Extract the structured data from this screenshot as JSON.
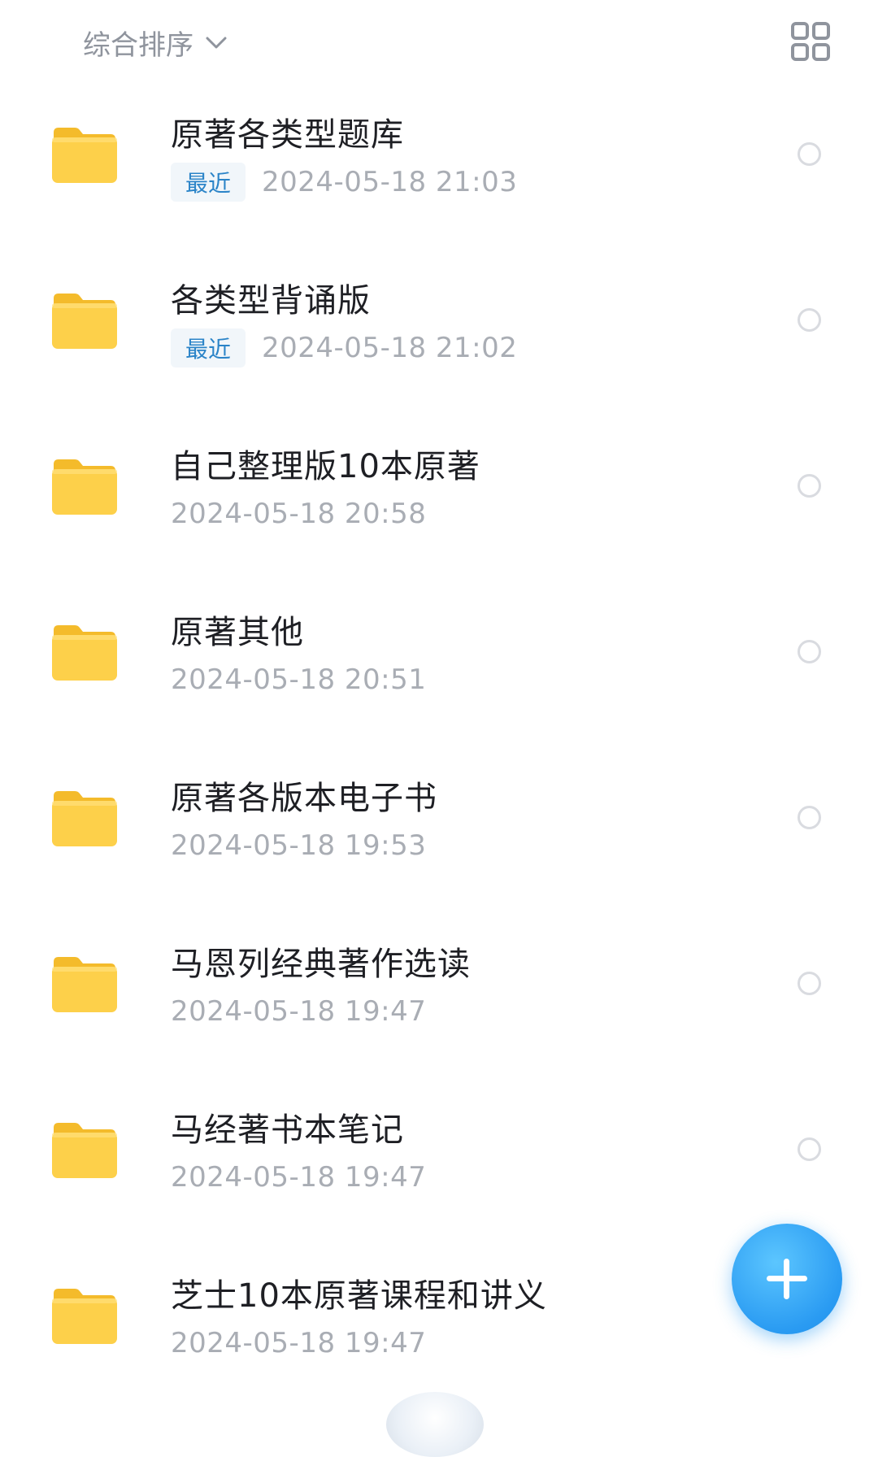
{
  "toolbar": {
    "sort_label": "综合排序",
    "sort_icon": "chevron-down-icon",
    "view_icon": "grid-view-icon"
  },
  "colors": {
    "folder": "#FDD04A",
    "accent": "#2A9BF2",
    "badge_text": "#2B84C8",
    "title_text": "#1E1F24",
    "date_text": "#A9ADB4"
  },
  "files": [
    {
      "name": "原著各类型题库",
      "badge": "最近",
      "date": "2024-05-18  21:03"
    },
    {
      "name": "各类型背诵版",
      "badge": "最近",
      "date": "2024-05-18  21:02"
    },
    {
      "name": "自己整理版10本原著",
      "badge": "",
      "date": "2024-05-18  20:58"
    },
    {
      "name": "原著其他",
      "badge": "",
      "date": "2024-05-18  20:51"
    },
    {
      "name": "原著各版本电子书",
      "badge": "",
      "date": "2024-05-18  19:53"
    },
    {
      "name": "马恩列经典著作选读",
      "badge": "",
      "date": "2024-05-18  19:47"
    },
    {
      "name": "马经著书本笔记",
      "badge": "",
      "date": "2024-05-18  19:47"
    },
    {
      "name": "芝士10本原著课程和讲义",
      "badge": "",
      "date": "2024-05-18  19:47"
    }
  ],
  "fab": {
    "icon": "plus-icon"
  }
}
